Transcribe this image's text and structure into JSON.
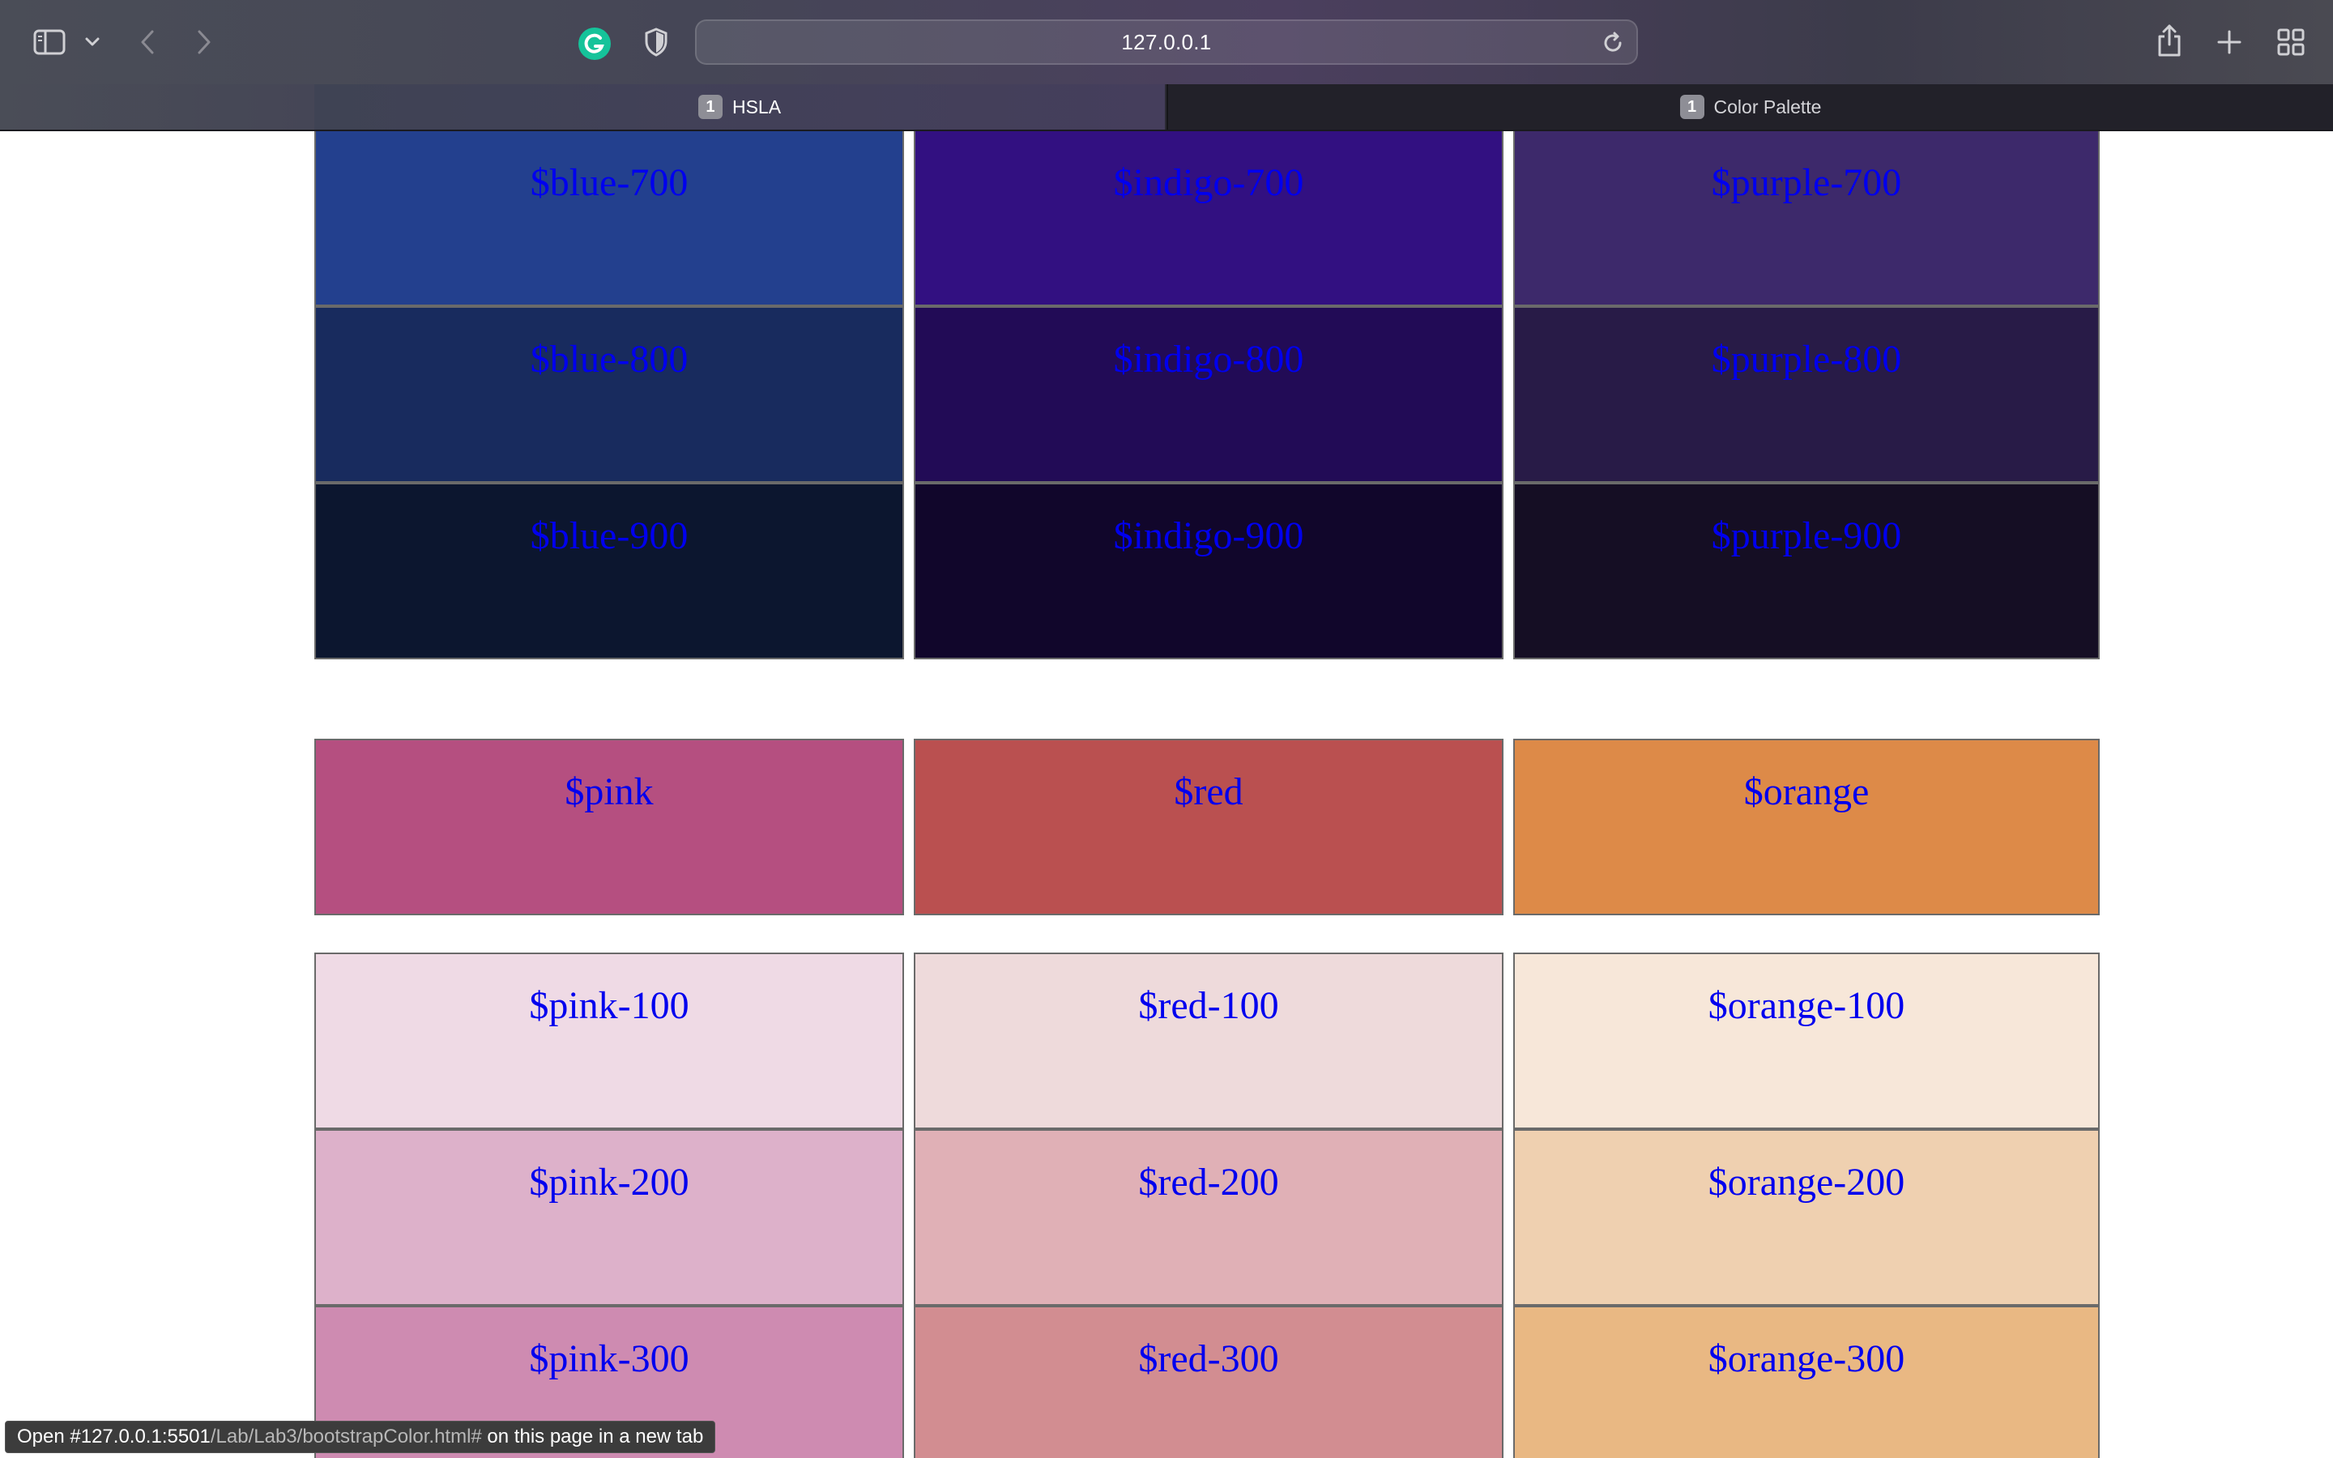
{
  "browser": {
    "url": "127.0.0.1",
    "tabs": [
      {
        "number": "1",
        "title": "HSLA",
        "active": true
      },
      {
        "number": "1",
        "title": "Color Palette",
        "active": false
      }
    ],
    "icons": {
      "sidebar": "sidebar-icon",
      "sidebar_menu": "chevron-down-icon",
      "back": "chevron-left-icon",
      "forward": "chevron-right-icon",
      "grammarly": "grammarly-icon",
      "privacy": "shield-icon",
      "reload": "reload-icon",
      "share": "share-icon",
      "new_tab": "plus-icon",
      "tab_overview": "grid-icon"
    }
  },
  "link_color": "#0000ee",
  "groups": [
    {
      "rows": [
        [
          {
            "label": "$blue-700",
            "color": "#23408e"
          },
          {
            "label": "$indigo-700",
            "color": "#321081"
          },
          {
            "label": "$purple-700",
            "color": "#3d296b"
          }
        ],
        [
          {
            "label": "$blue-800",
            "color": "#182b5e"
          },
          {
            "label": "$indigo-800",
            "color": "#220b56"
          },
          {
            "label": "$purple-800",
            "color": "#281b47"
          }
        ],
        [
          {
            "label": "$blue-900",
            "color": "#0c162f"
          },
          {
            "label": "$indigo-900",
            "color": "#11062b"
          },
          {
            "label": "$purple-900",
            "color": "#150e24"
          }
        ]
      ]
    },
    {
      "rows": [
        [
          {
            "label": "$pink",
            "color": "#b54f80"
          },
          {
            "label": "$red",
            "color": "#ba5050"
          },
          {
            "label": "$orange",
            "color": "#dd8a48"
          }
        ]
      ]
    },
    {
      "rows": [
        [
          {
            "label": "$pink-100",
            "color": "#efdae5"
          },
          {
            "label": "$red-100",
            "color": "#eedadb"
          },
          {
            "label": "$orange-100",
            "color": "#f7e7d9"
          }
        ],
        [
          {
            "label": "$pink-200",
            "color": "#ddb1ca"
          },
          {
            "label": "$red-200",
            "color": "#e0b0b6"
          },
          {
            "label": "$orange-200",
            "color": "#efd0b0"
          }
        ],
        [
          {
            "label": "$pink-300",
            "color": "#ce8bb1"
          },
          {
            "label": "$red-300",
            "color": "#d28d91"
          },
          {
            "label": "$orange-300",
            "color": "#e9b883"
          }
        ]
      ]
    }
  ],
  "status_bar": {
    "prefix": "Open #127.0.0.1:5501",
    "path": "/Lab/Lab3/bootstrapColor.html#",
    "suffix": " on this page in a new tab"
  }
}
